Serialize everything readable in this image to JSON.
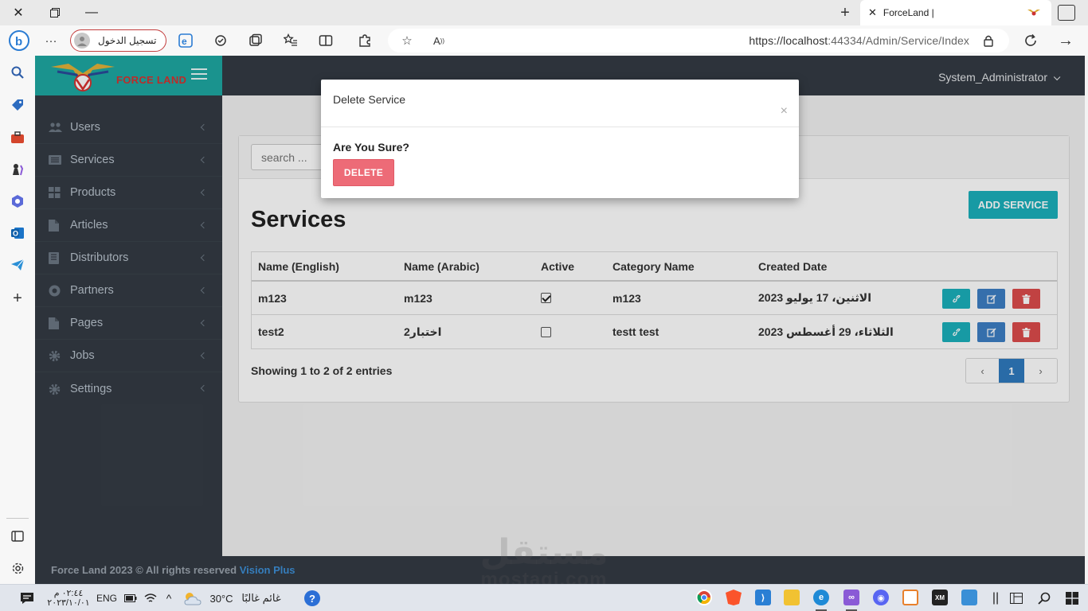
{
  "browser": {
    "tab_title": "ForceLand |",
    "url_prefix": "https://",
    "url_host": "localhost",
    "url_rest": ":44334/Admin/Service/Index",
    "signin_label": "تسجيل الدخول"
  },
  "app": {
    "logo_text": "FORCE LAND",
    "user_name": "System_Administrator",
    "colors": {
      "teal": "#1ea8a2",
      "dark": "#343b44",
      "primary": "#2f7abf",
      "danger": "#dc4c4c",
      "info": "#1bb0bb",
      "logo_red": "#d8322f"
    }
  },
  "sidebar": {
    "items": [
      {
        "label": "Users",
        "icon": "users-icon"
      },
      {
        "label": "Services",
        "icon": "list-icon"
      },
      {
        "label": "Products",
        "icon": "grid-icon"
      },
      {
        "label": "Articles",
        "icon": "file-icon"
      },
      {
        "label": "Distributors",
        "icon": "book-icon"
      },
      {
        "label": "Partners",
        "icon": "star-icon"
      },
      {
        "label": "Pages",
        "icon": "file-icon"
      },
      {
        "label": "Jobs",
        "icon": "gear-icon"
      },
      {
        "label": "Settings",
        "icon": "gear-icon"
      }
    ]
  },
  "page": {
    "title": "Services",
    "search_placeholder": "search ...",
    "add_button": "ADD SERVICE",
    "table": {
      "headers": [
        "Name (English)",
        "Name (Arabic)",
        "Active",
        "Category Name",
        "Created Date"
      ],
      "rows": [
        {
          "name_en": "m123",
          "name_ar": "m123",
          "active": true,
          "category": "m123",
          "created": "2023 الاثنين، 17 يوليو"
        },
        {
          "name_en": "test2",
          "name_ar": "اختبار2",
          "active": false,
          "category": "testt test",
          "created": "2023 الثلاثاء، 29 أغسطس"
        }
      ]
    },
    "showing": "Showing 1 to 2 of 2 entries",
    "pagination": {
      "current": "1",
      "prev": "‹",
      "next": "›"
    }
  },
  "modal": {
    "title": "Delete Service",
    "close": "×",
    "question": "Are You Sure?",
    "delete_button": "DELETE"
  },
  "footer": {
    "copyright": "Force Land 2023 © All rights reserved ",
    "brand": "Vision Plus"
  },
  "watermark": {
    "arabic": "مستقل",
    "latin": "mostaqi.com"
  },
  "taskbar": {
    "time": "٠٢:٤٤ م",
    "date": "٢٠٢٣/١٠/٠١",
    "lang": "ENG",
    "temperature": "30°C",
    "weather": "غائم غالبًا"
  }
}
